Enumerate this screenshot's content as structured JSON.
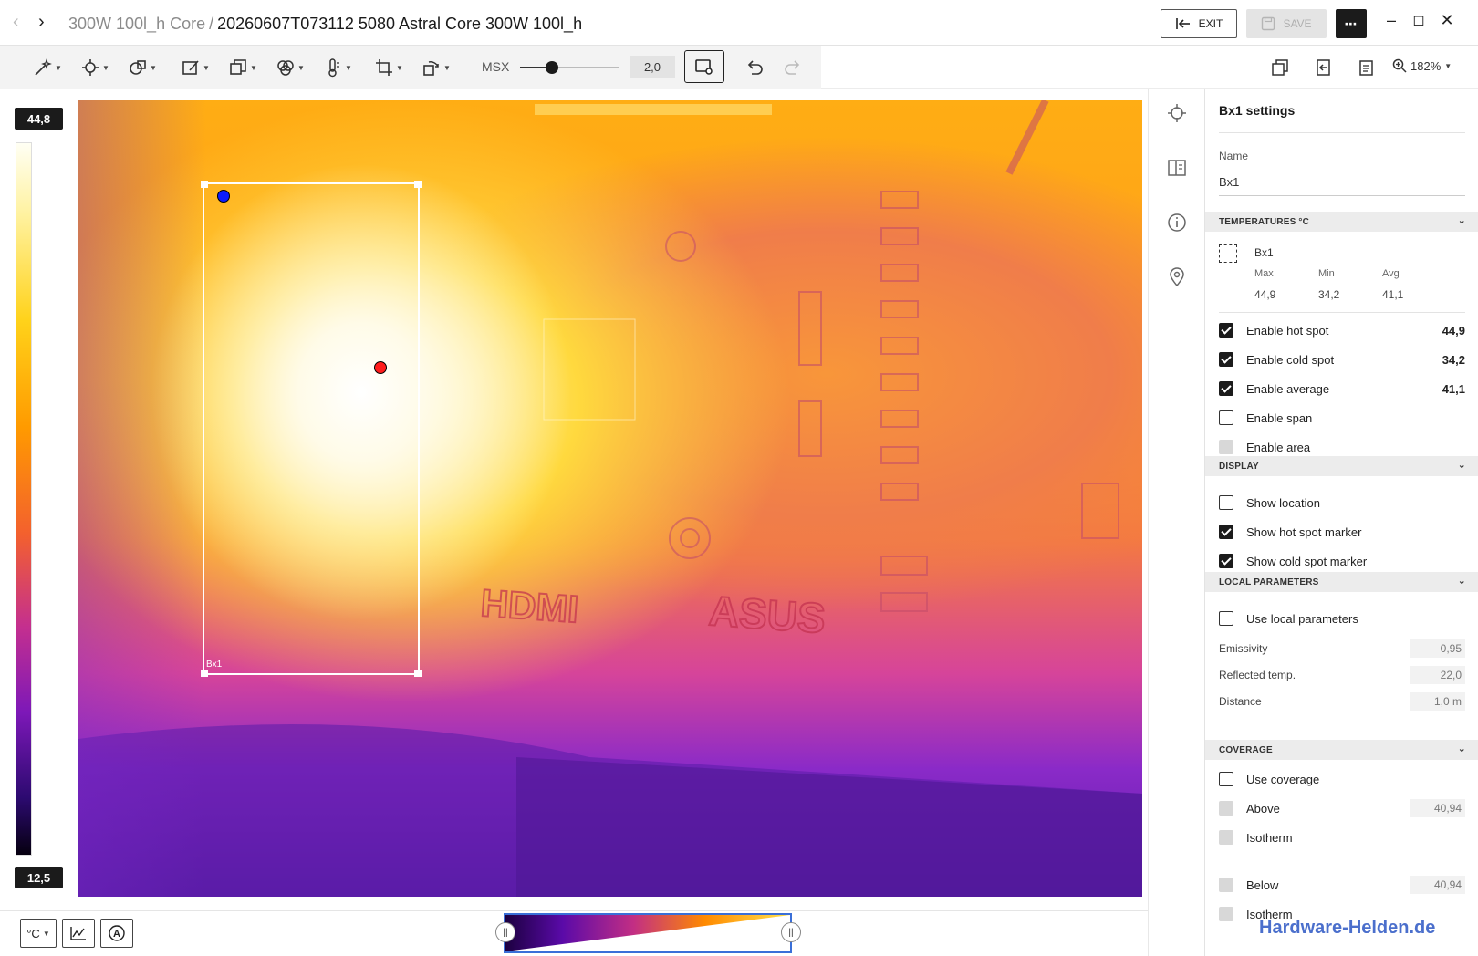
{
  "titlebar": {
    "breadcrumb_parent": "300W 100l_h Core",
    "breadcrumb_sep": "/",
    "breadcrumb_current": "20260607T073112 5080 Astral Core 300W 100l_h",
    "exit_label": "EXIT",
    "save_label": "SAVE"
  },
  "toolbar": {
    "msx_label": "MSX",
    "msx_value": "2,0",
    "msx_level": 0.33,
    "zoom_label": "182%"
  },
  "scale": {
    "max": "44,8",
    "min": "12,5"
  },
  "image": {
    "box_label": "Bx1"
  },
  "bottombar": {
    "unit_label": "°C"
  },
  "panel": {
    "title": "Bx1 settings",
    "name_label": "Name",
    "name_value": "Bx1",
    "temperatures": {
      "heading": "TEMPERATURES °C",
      "item_name": "Bx1",
      "max_label": "Max",
      "min_label": "Min",
      "avg_label": "Avg",
      "max_value": "44,9",
      "min_value": "34,2",
      "avg_value": "41,1",
      "options": [
        {
          "label": "Enable hot spot",
          "value": "44,9",
          "state": "checked"
        },
        {
          "label": "Enable cold spot",
          "value": "34,2",
          "state": "checked"
        },
        {
          "label": "Enable average",
          "value": "41,1",
          "state": "checked"
        },
        {
          "label": "Enable span",
          "value": "",
          "state": "unchecked"
        },
        {
          "label": "Enable area",
          "value": "",
          "state": "disabled"
        }
      ]
    },
    "display": {
      "heading": "DISPLAY",
      "options": [
        {
          "label": "Show location",
          "state": "unchecked"
        },
        {
          "label": "Show hot spot marker",
          "state": "checked"
        },
        {
          "label": "Show cold spot marker",
          "state": "checked"
        }
      ]
    },
    "local_parameters": {
      "heading": "LOCAL PARAMETERS",
      "use_label": "Use local parameters",
      "params": [
        {
          "label": "Emissivity",
          "value": "0,95"
        },
        {
          "label": "Reflected temp.",
          "value": "22,0"
        },
        {
          "label": "Distance",
          "value": "1,0 m"
        }
      ]
    },
    "coverage": {
      "heading": "COVERAGE",
      "use_label": "Use coverage",
      "above_label": "Above",
      "above_value": "40,94",
      "isotherm_label_1": "Isotherm",
      "below_label": "Below",
      "below_value": "40,94",
      "isotherm_label_2": "Isotherm"
    }
  },
  "watermark": "Hardware-Helden.de"
}
